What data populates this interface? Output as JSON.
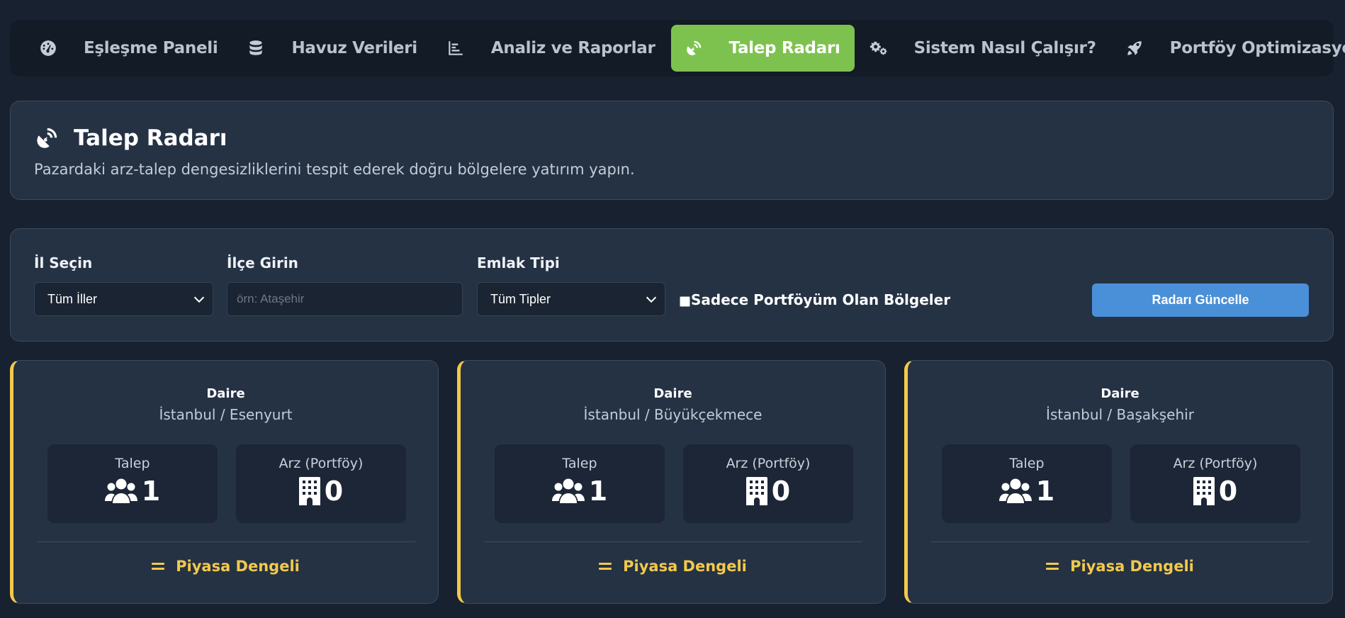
{
  "nav": {
    "items": [
      {
        "label": "Eşleşme Paneli",
        "icon": "gauge-icon",
        "active": false
      },
      {
        "label": "Havuz Verileri",
        "icon": "database-icon",
        "active": false
      },
      {
        "label": "Analiz ve Raporlar",
        "icon": "bar-chart-icon",
        "active": false
      },
      {
        "label": "Talep Radarı",
        "icon": "satellite-dish-icon",
        "active": true
      },
      {
        "label": "Sistem Nasıl Çalışır?",
        "icon": "gears-icon",
        "active": false
      },
      {
        "label": "Portföy Optimizasyonu",
        "icon": "rocket-icon",
        "active": false
      }
    ]
  },
  "header": {
    "title": "Talep Radarı",
    "description": "Pazardaki arz-talep dengesizliklerini tespit ederek doğru bölgelere yatırım yapın."
  },
  "filters": {
    "province_label": "İl Seçin",
    "province_value": "Tüm İller",
    "district_label": "İlçe Girin",
    "district_placeholder": "örn: Ataşehir",
    "type_label": "Emlak Tipi",
    "type_value": "Tüm Tipler",
    "only_portfolio_label": "Sadece Portföyüm Olan Bölgeler",
    "only_portfolio_checked": false,
    "update_button": "Radarı Güncelle"
  },
  "cards": [
    {
      "type": "Daire",
      "location": "İstanbul / Esenyurt",
      "demand_label": "Talep",
      "demand": "1",
      "supply_label": "Arz (Portföy)",
      "supply": "0",
      "status": "Piyasa Dengeli"
    },
    {
      "type": "Daire",
      "location": "İstanbul / Büyükçekmece",
      "demand_label": "Talep",
      "demand": "1",
      "supply_label": "Arz (Portföy)",
      "supply": "0",
      "status": "Piyasa Dengeli"
    },
    {
      "type": "Daire",
      "location": "İstanbul / Başakşehir",
      "demand_label": "Talep",
      "demand": "1",
      "supply_label": "Arz (Portföy)",
      "supply": "0",
      "status": "Piyasa Dengeli"
    }
  ],
  "colors": {
    "background": "#172130",
    "panel": "#253244",
    "active_tab": "#7dc24e",
    "primary_button": "#4a90d9",
    "status_balanced": "#f2c94c"
  }
}
